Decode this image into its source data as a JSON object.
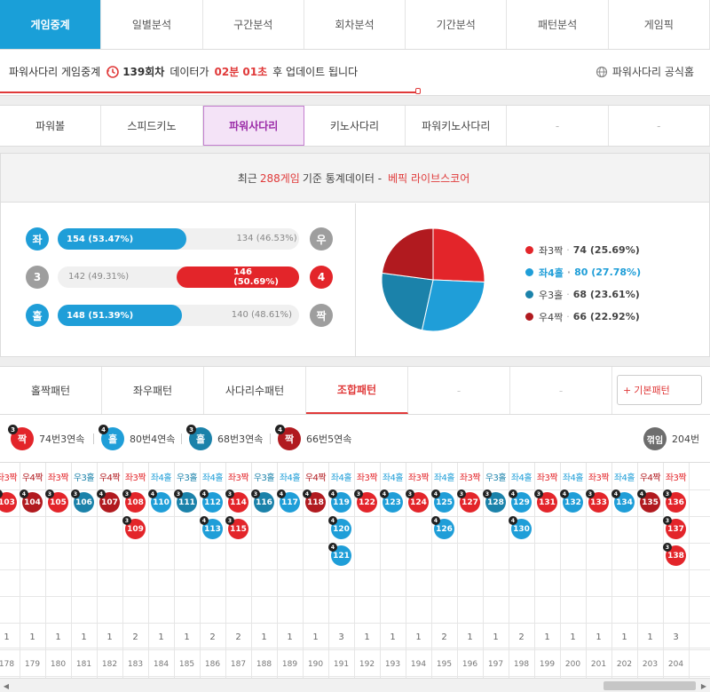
{
  "top_nav": [
    "게임중계",
    "일별분석",
    "구간분석",
    "회차분석",
    "기간분석",
    "패턴분석",
    "게임픽"
  ],
  "status": {
    "prefix": "파워사다리 게임중계",
    "round": "139회차",
    "mid": "데이터가",
    "time": "02분 01초",
    "suffix": "후 업데이트 됩니다",
    "official": "파워사다리 공식홈",
    "progress": 0.59
  },
  "game_tabs": [
    "파워볼",
    "스피드키노",
    "파워사다리",
    "키노사다리",
    "파워키노사다리",
    "-",
    "-"
  ],
  "stats_header": {
    "pre": "최근",
    "count": "288게임",
    "mid": "기준 통계데이터 -",
    "brand": "베픽 라이브스코어"
  },
  "bars": [
    {
      "left_label": "좌",
      "right_label": "우",
      "left_text": "154 (53.47%)",
      "right_text": "134 (46.53%)",
      "left_pct": 53.47,
      "winner": "left",
      "left_color": "blue",
      "right_color": "gray"
    },
    {
      "left_label": "3",
      "right_label": "4",
      "left_text": "142 (49.31%)",
      "right_text": "146 (50.69%)",
      "left_pct": 49.31,
      "winner": "right",
      "left_color": "gray",
      "right_color": "red"
    },
    {
      "left_label": "홀",
      "right_label": "짝",
      "left_text": "148 (51.39%)",
      "right_text": "140 (48.61%)",
      "left_pct": 51.39,
      "winner": "left",
      "left_color": "blue",
      "right_color": "gray"
    }
  ],
  "chart_data": {
    "type": "pie",
    "categories": [
      "좌3짝",
      "좌4홀",
      "우3홀",
      "우4짝"
    ],
    "values": [
      74,
      80,
      68,
      66
    ],
    "labels": [
      "74 (25.69%)",
      "80 (27.78%)",
      "68 (23.61%)",
      "66 (22.92%)"
    ],
    "colors": [
      "#e3252a",
      "#1f9ed8",
      "#1b82aa",
      "#b11a1f"
    ]
  },
  "pattern_tabs": [
    "홀짝패턴",
    "좌우패턴",
    "사다리수패턴",
    "조합패턴",
    "-",
    "-"
  ],
  "basic_pattern": "기본패턴",
  "summary": [
    {
      "label": "짝",
      "sup": "3",
      "text": "74번3연속",
      "color": "#e3252a"
    },
    {
      "label": "홀",
      "sup": "4",
      "text": "80번4연속",
      "color": "#1f9ed8"
    },
    {
      "label": "홀",
      "sup": "3",
      "text": "68번3연속",
      "color": "#1b82aa"
    },
    {
      "label": "짝",
      "sup": "4",
      "text": "66번5연속",
      "color": "#b11a1f"
    }
  ],
  "total": {
    "label": "꺾임",
    "text": "204번"
  },
  "colors": {
    "좌3짝": "#e3252a",
    "좌4홀": "#1f9ed8",
    "우3홀": "#1b82aa",
    "우4짝": "#b11a1f"
  },
  "columns": [
    {
      "type": "좌3짝",
      "sup": "3",
      "balls": [
        "103"
      ],
      "count": "1",
      "round": "178"
    },
    {
      "type": "우4짝",
      "sup": "4",
      "balls": [
        "104"
      ],
      "count": "1",
      "round": "179"
    },
    {
      "type": "좌3짝",
      "sup": "3",
      "balls": [
        "105"
      ],
      "count": "1",
      "round": "180"
    },
    {
      "type": "우3홀",
      "sup": "3",
      "balls": [
        "106"
      ],
      "count": "1",
      "round": "181"
    },
    {
      "type": "우4짝",
      "sup": "4",
      "balls": [
        "107"
      ],
      "count": "1",
      "round": "182"
    },
    {
      "type": "좌3짝",
      "sup": "3",
      "balls": [
        "108",
        "109"
      ],
      "count": "2",
      "round": "183"
    },
    {
      "type": "좌4홀",
      "sup": "4",
      "balls": [
        "110"
      ],
      "count": "1",
      "round": "184"
    },
    {
      "type": "우3홀",
      "sup": "3",
      "balls": [
        "111"
      ],
      "count": "1",
      "round": "185"
    },
    {
      "type": "좌4홀",
      "sup": "4",
      "balls": [
        "112",
        "113"
      ],
      "count": "2",
      "round": "186"
    },
    {
      "type": "좌3짝",
      "sup": "3",
      "balls": [
        "114",
        "115"
      ],
      "count": "2",
      "round": "187"
    },
    {
      "type": "우3홀",
      "sup": "3",
      "balls": [
        "116"
      ],
      "count": "1",
      "round": "188"
    },
    {
      "type": "좌4홀",
      "sup": "4",
      "balls": [
        "117"
      ],
      "count": "1",
      "round": "189"
    },
    {
      "type": "우4짝",
      "sup": "4",
      "balls": [
        "118"
      ],
      "count": "1",
      "round": "190"
    },
    {
      "type": "좌4홀",
      "sup": "4",
      "balls": [
        "119",
        "120",
        "121"
      ],
      "count": "3",
      "round": "191"
    },
    {
      "type": "좌3짝",
      "sup": "3",
      "balls": [
        "122"
      ],
      "count": "1",
      "round": "192"
    },
    {
      "type": "좌4홀",
      "sup": "4",
      "balls": [
        "123"
      ],
      "count": "1",
      "round": "193"
    },
    {
      "type": "좌3짝",
      "sup": "3",
      "balls": [
        "124"
      ],
      "count": "1",
      "round": "194"
    },
    {
      "type": "좌4홀",
      "sup": "4",
      "balls": [
        "125",
        "126"
      ],
      "count": "2",
      "round": "195"
    },
    {
      "type": "좌3짝",
      "sup": "3",
      "balls": [
        "127"
      ],
      "count": "1",
      "round": "196"
    },
    {
      "type": "우3홀",
      "sup": "3",
      "balls": [
        "128"
      ],
      "count": "1",
      "round": "197"
    },
    {
      "type": "좌4홀",
      "sup": "4",
      "balls": [
        "129",
        "130"
      ],
      "count": "2",
      "round": "198"
    },
    {
      "type": "좌3짝",
      "sup": "3",
      "balls": [
        "131"
      ],
      "count": "1",
      "round": "199"
    },
    {
      "type": "좌4홀",
      "sup": "4",
      "balls": [
        "132"
      ],
      "count": "1",
      "round": "200"
    },
    {
      "type": "좌3짝",
      "sup": "3",
      "balls": [
        "133"
      ],
      "count": "1",
      "round": "201"
    },
    {
      "type": "좌4홀",
      "sup": "4",
      "balls": [
        "134"
      ],
      "count": "1",
      "round": "202"
    },
    {
      "type": "우4짝",
      "sup": "4",
      "balls": [
        "135"
      ],
      "count": "1",
      "round": "203"
    },
    {
      "type": "좌3짝",
      "sup": "3",
      "balls": [
        "136",
        "137",
        "138"
      ],
      "count": "3",
      "round": "204"
    }
  ]
}
